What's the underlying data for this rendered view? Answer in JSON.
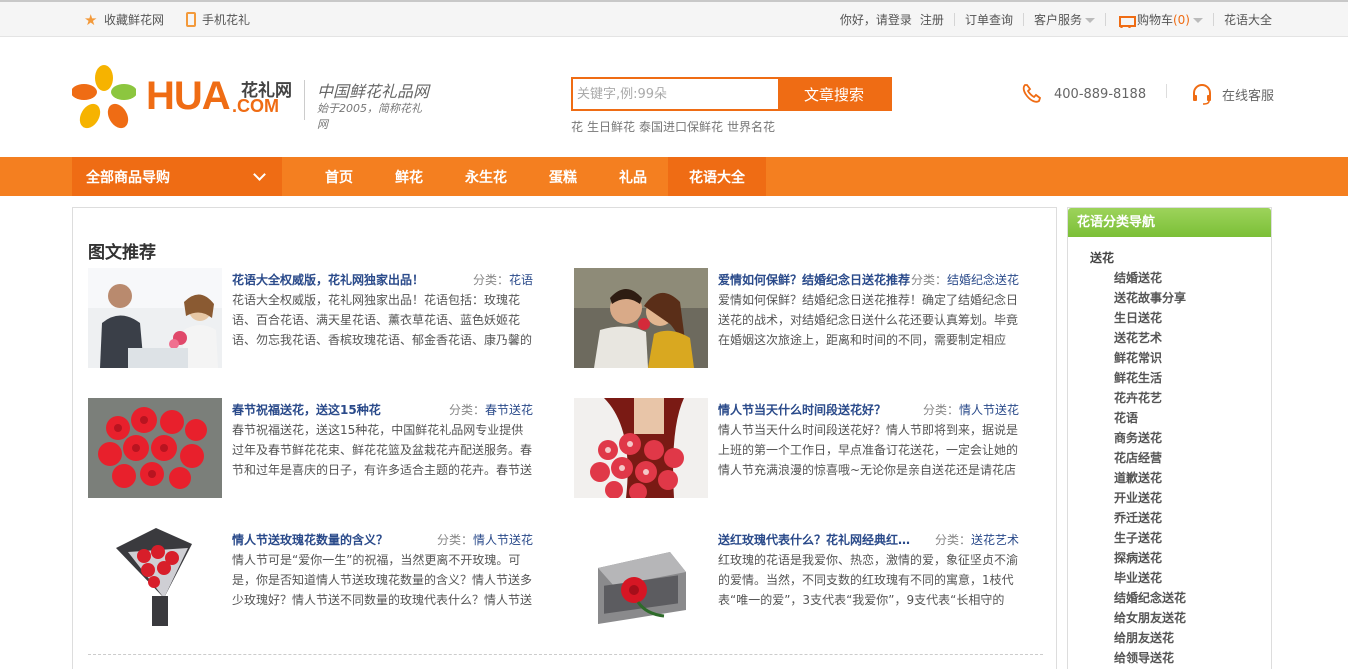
{
  "topbar": {
    "favorite": "收藏鲜花网",
    "mobile": "手机花礼",
    "greeting": "你好，请登录",
    "register": "注册",
    "orders": "订单查询",
    "service": "客户服务",
    "cart": "购物车",
    "cart_count": "(0)",
    "flower_lang": "花语大全"
  },
  "logo": {
    "brand": "HUA",
    "brand_cn": "花礼网",
    "dot_com": ".COM",
    "name": "中国鲜花礼品网",
    "slogan": "始于2005，简称花礼网"
  },
  "search": {
    "placeholder": "关键字,例:99朵",
    "button": "文章搜索",
    "hotwords": [
      "花",
      "生日鲜花",
      "泰国进口保鲜花",
      "世界名花"
    ]
  },
  "contact": {
    "phone": "400-889-8188",
    "online": "在线客服"
  },
  "nav": {
    "all_label": "全部商品导购",
    "items": [
      "首页",
      "鲜花",
      "永生花",
      "蛋糕",
      "礼品",
      "花语大全"
    ]
  },
  "main": {
    "title": "图文推荐",
    "cat_prefix": "分类：",
    "articles": [
      {
        "title": "花语大全权威版，花礼网独家出品！",
        "category": "花语",
        "desc": "花语大全权威版，花礼网独家出品！花语包括：玫瑰花语、百合花语、满天星花语、薰衣草花语、蓝色妖姬花语、勿忘我花语、香槟玫瑰花语、郁金香花语、康乃馨的"
      },
      {
        "title": "爱情如何保鲜？结婚纪念日送花推荐",
        "category": "结婚纪念送花",
        "desc": "爱情如何保鲜？结婚纪念日送花推荐！确定了结婚纪念日送花的战术，对结婚纪念日送什么花还要认真筹划。毕竟在婚姻这次旅途上，距离和时间的不同，需要制定相应"
      },
      {
        "title": "春节祝福送花，送这15种花",
        "category": "春节送花",
        "desc": "春节祝福送花，送这15种花，中国鲜花礼品网专业提供过年及春节鲜花花束、鲜花花篮及盆栽花卉配送服务。春节和过年是喜庆的日子，有许多适合主题的花卉。春节送"
      },
      {
        "title": "情人节当天什么时间段送花好？",
        "category": "情人节送花",
        "desc": "情人节当天什么时间段送花好？情人节即将到来，据说是上班的第一个工作日，早点准备订花送花，一定会让她的情人节充满浪漫的惊喜哦~无论你是亲自送花还是请花店"
      },
      {
        "title": "情人节送玫瑰花数量的含义？",
        "category": "情人节送花",
        "desc": "情人节可是“爱你一生”的祝福，当然更离不开玫瑰。可是，你是否知道情人节送玫瑰花数量的含义？情人节送多少玫瑰好？情人节送不同数量的玫瑰代表什么？情人节送"
      },
      {
        "title": "送红玫瑰代表什么？花礼网经典红玫瑰",
        "category": "送花艺术",
        "desc": "红玫瑰的花语是我爱你、热恋，激情的爱，象征坚贞不渝的爱情。当然，不同支数的红玫瑰有不同的寓意，1枝代表“唯一的爱”，3支代表“我爱你”，9支代表“长相守的"
      }
    ]
  },
  "sidebar": {
    "title": "花语分类导航",
    "root": "送花",
    "items": [
      "结婚送花",
      "送花故事分享",
      "生日送花",
      "送花艺术",
      "鲜花常识",
      "鲜花生活",
      "花卉花艺",
      "花语",
      "商务送花",
      "花店经营",
      "道歉送花",
      "开业送花",
      "乔迁送花",
      "生子送花",
      "探病送花",
      "毕业送花",
      "结婚纪念送花",
      "给女朋友送花",
      "给朋友送花",
      "给领导送花"
    ]
  }
}
